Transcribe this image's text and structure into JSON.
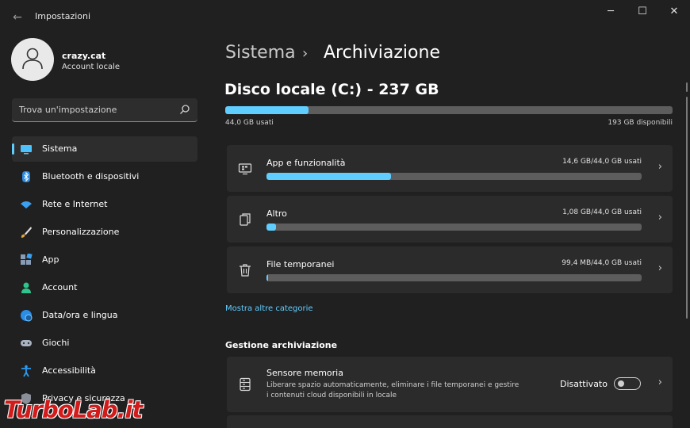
{
  "window": {
    "title": "Impostazioni",
    "back": "←",
    "minimize": "─",
    "maximize": "☐",
    "close": "✕"
  },
  "user": {
    "name": "crazy.cat",
    "type": "Account locale"
  },
  "search": {
    "placeholder": "Trova un'impostazione"
  },
  "nav": [
    {
      "label": "Sistema",
      "icon": "system-icon",
      "active": true
    },
    {
      "label": "Bluetooth e dispositivi",
      "icon": "bluetooth-icon"
    },
    {
      "label": "Rete e Internet",
      "icon": "wifi-icon"
    },
    {
      "label": "Personalizzazione",
      "icon": "brush-icon"
    },
    {
      "label": "App",
      "icon": "apps-icon"
    },
    {
      "label": "Account",
      "icon": "account-icon"
    },
    {
      "label": "Data/ora e lingua",
      "icon": "globe-icon"
    },
    {
      "label": "Giochi",
      "icon": "gamepad-icon"
    },
    {
      "label": "Accessibilità",
      "icon": "accessibility-icon"
    },
    {
      "label": "Privacy e sicurezza",
      "icon": "shield-icon"
    }
  ],
  "breadcrumb": {
    "parent": "Sistema",
    "separator": "›",
    "current": "Archiviazione"
  },
  "disk": {
    "title": "Disco locale (C:) - 237 GB",
    "used": "44,0 GB usati",
    "free": "193 GB disponibili",
    "used_fraction": 0.186
  },
  "categories": [
    {
      "name": "App e funzionalità",
      "size": "14,6 GB/44,0 GB usati",
      "fraction": 0.332,
      "icon": "apps-monitor-icon"
    },
    {
      "name": "Altro",
      "size": "1,08 GB/44,0 GB usati",
      "fraction": 0.025,
      "icon": "other-files-icon"
    },
    {
      "name": "File temporanei",
      "size": "99,4 MB/44,0 GB usati",
      "fraction": 0.003,
      "icon": "trash-icon"
    }
  ],
  "more_link": "Mostra altre categorie",
  "section": {
    "title": "Gestione archiviazione"
  },
  "storage_sense": {
    "name": "Sensore memoria",
    "description": "Liberare spazio automaticamente, eliminare i file temporanei e gestire i contenuti cloud disponibili in locale",
    "state": "Disattivato"
  },
  "chevron": "›",
  "watermark": "TurboLab.it",
  "colors": {
    "accent": "#60cdff",
    "background": "#202020",
    "card": "#2b2b2b",
    "watermark": "#d21b1b"
  }
}
